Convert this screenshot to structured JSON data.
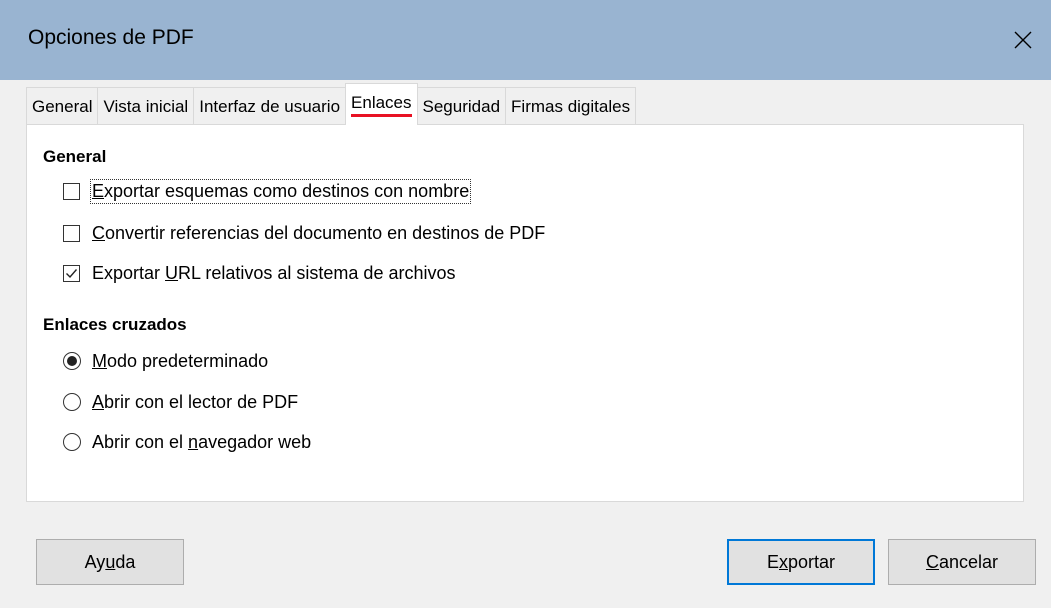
{
  "window": {
    "title": "Opciones de PDF"
  },
  "tabs": [
    {
      "label": "General"
    },
    {
      "label": "Vista inicial"
    },
    {
      "label": "Interfaz de usuario"
    },
    {
      "label": "Enlaces",
      "active": true
    },
    {
      "label": "Seguridad"
    },
    {
      "label": "Firmas digitales"
    }
  ],
  "general_section": {
    "title": "General",
    "options": [
      {
        "pre": "",
        "mnemonic": "E",
        "post": "xportar esquemas como destinos con nombre",
        "checked": false
      },
      {
        "pre": "",
        "mnemonic": "C",
        "post": "onvertir referencias del documento en destinos de PDF",
        "checked": false
      },
      {
        "pre": "Exportar ",
        "mnemonic": "U",
        "post": "RL relativos al sistema de archivos",
        "checked": true
      }
    ]
  },
  "crossdoc_section": {
    "title": "Enlaces cruzados",
    "options": [
      {
        "pre": "",
        "mnemonic": "M",
        "post": "odo predeterminado",
        "selected": true
      },
      {
        "pre": "",
        "mnemonic": "A",
        "post": "brir con el lector de PDF",
        "selected": false
      },
      {
        "pre": "Abrir con el ",
        "mnemonic": "n",
        "post": "avegador web",
        "selected": false
      }
    ]
  },
  "buttons": {
    "help": {
      "pre": "Ay",
      "mnemonic": "u",
      "post": "da"
    },
    "export": {
      "pre": "E",
      "mnemonic": "x",
      "post": "portar"
    },
    "cancel": {
      "pre": "",
      "mnemonic": "C",
      "post": "ancelar"
    }
  }
}
